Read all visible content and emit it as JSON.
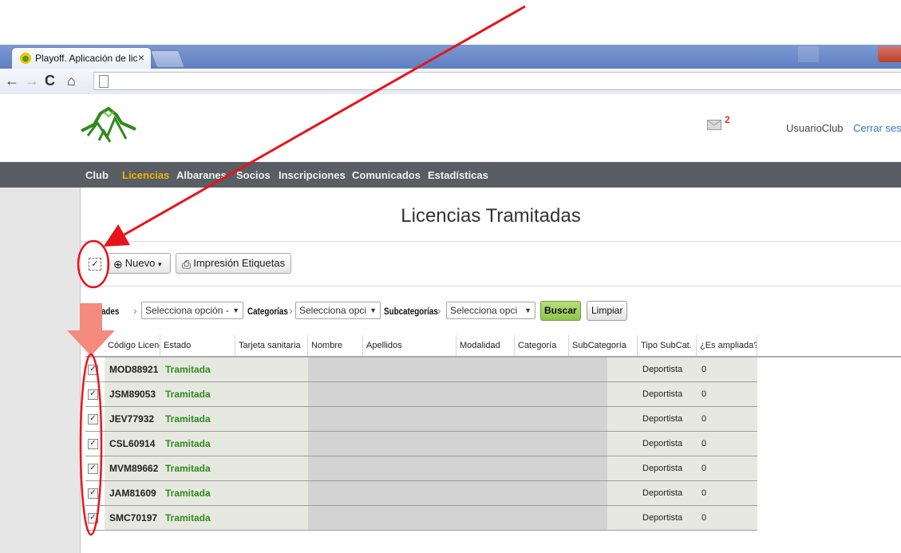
{
  "browser": {
    "tab_title": "Playoff. Aplicación de licer",
    "tab_close": "×",
    "nav_back": "←",
    "nav_forward": "→",
    "nav_reload": "C",
    "nav_home": "⌂"
  },
  "header": {
    "mail_count": "2",
    "user_name": "UsuarioClub",
    "logout_label": "Cerrar sesión"
  },
  "nav": {
    "items": [
      "Club",
      "Licencias",
      "Albaranes",
      "Socios",
      "Inscripciones",
      "Comunicados",
      "Estadísticas"
    ],
    "active": "Licencias"
  },
  "page": {
    "title": "Licencias Tramitadas"
  },
  "toolbar": {
    "select_all_mark": "✓",
    "new_label": "Nuevo",
    "new_caret": "▾",
    "print_labels": "Impresión Etiquetas"
  },
  "filters": {
    "modalidades_label": "alidades",
    "modalidades_value": "Selecciona opción -",
    "categorias_label": "Categorías",
    "categorias_value": "Selecciona opci",
    "subcategorias_label": "Subcategorías",
    "subcategorias_value": "Selecciona opci",
    "chevron": "›",
    "search_button": "Buscar",
    "clear_button": "Limpiar"
  },
  "table": {
    "columns": [
      "Código Licencia",
      "Estado",
      "Tarjeta sanitaria",
      "Nombre",
      "Apellidos",
      "Modalidad",
      "Categoría",
      "SubCategoría",
      "Tipo SubCat.",
      "¿Es ampliada?("
    ],
    "rows": [
      {
        "codigo": "MOD88921",
        "estado": "Tramitada",
        "tipo": "Deportista",
        "ampliada": "0"
      },
      {
        "codigo": "JSM89053",
        "estado": "Tramitada",
        "tipo": "Deportista",
        "ampliada": "0"
      },
      {
        "codigo": "JEV77932",
        "estado": "Tramitada",
        "tipo": "Deportista",
        "ampliada": "0"
      },
      {
        "codigo": "CSL60914",
        "estado": "Tramitada",
        "tipo": "Deportista",
        "ampliada": "0"
      },
      {
        "codigo": "MVM89662",
        "estado": "Tramitada",
        "tipo": "Deportista",
        "ampliada": "0"
      },
      {
        "codigo": "JAM81609",
        "estado": "Tramitada",
        "tipo": "Deportista",
        "ampliada": "0"
      },
      {
        "codigo": "SMC70197",
        "estado": "Tramitada",
        "tipo": "Deportista",
        "ampliada": "0"
      }
    ],
    "check_mark": "✓"
  },
  "colors": {
    "nav_bg": "#585e64",
    "nav_active": "#f0b400",
    "estado_green": "#2f8a1e",
    "row_bg": "#e7e8e0",
    "masked_bg": "#d3d3d3",
    "annotation_red": "#e8141b",
    "annotation_salmon": "#f58a7f",
    "search_green": "#8ec44c"
  }
}
